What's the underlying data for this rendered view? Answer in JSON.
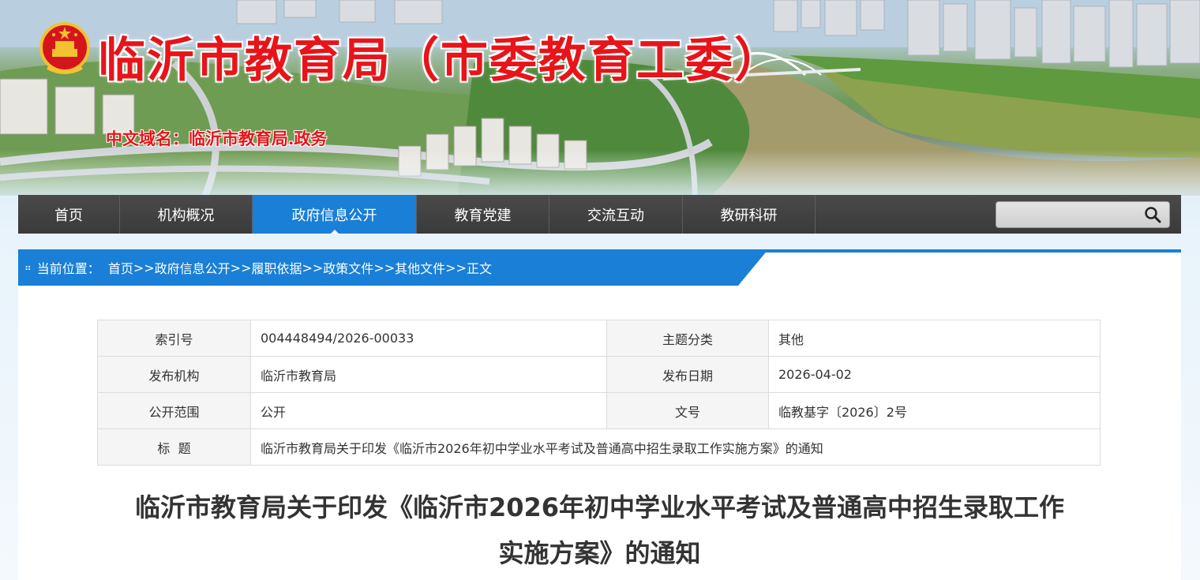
{
  "header": {
    "site_title": "临沂市教育局（市委教育工委）",
    "domain_label": "中文域名：临沂市教育局.政务",
    "emblem_icon": "national-emblem-icon"
  },
  "nav": {
    "items": [
      {
        "label": "首页",
        "active": false
      },
      {
        "label": "机构概况",
        "active": false
      },
      {
        "label": "政府信息公开",
        "active": true
      },
      {
        "label": "教育党建",
        "active": false
      },
      {
        "label": "交流互动",
        "active": false
      },
      {
        "label": "教研科研",
        "active": false
      }
    ],
    "search": {
      "placeholder": "",
      "icon": "search-icon"
    }
  },
  "breadcrumb": {
    "label": "当前位置：",
    "items": [
      "首页",
      "政府信息公开",
      "履职依据",
      "政策文件",
      "其他文件",
      "正文"
    ],
    "separator": ">>"
  },
  "meta_table": {
    "rows": [
      {
        "k1": "索引号",
        "v1": "004448494/2026-00033",
        "k2": "主题分类",
        "v2": "其他"
      },
      {
        "k1": "发布机构",
        "v1": "临沂市教育局",
        "k2": "发布日期",
        "v2": "2026-04-02"
      },
      {
        "k1": "公开范围",
        "v1": "公开",
        "k2": "文号",
        "v2": "临教基字〔2026〕2号"
      }
    ],
    "title_row": {
      "k": "标  题",
      "v": "临沂市教育局关于印发《临沂市2026年初中学业水平考试及普通高中招生录取工作实施方案》的通知"
    }
  },
  "article": {
    "title_line1": "临沂市教育局关于印发《临沂市2026年初中学业水平考试及普通高中招生录取工作",
    "title_line2": "实施方案》的通知"
  },
  "colors": {
    "accent": "#1a7fd6",
    "nav_bg": "#3d3d3d",
    "title_red": "#e8141a"
  }
}
